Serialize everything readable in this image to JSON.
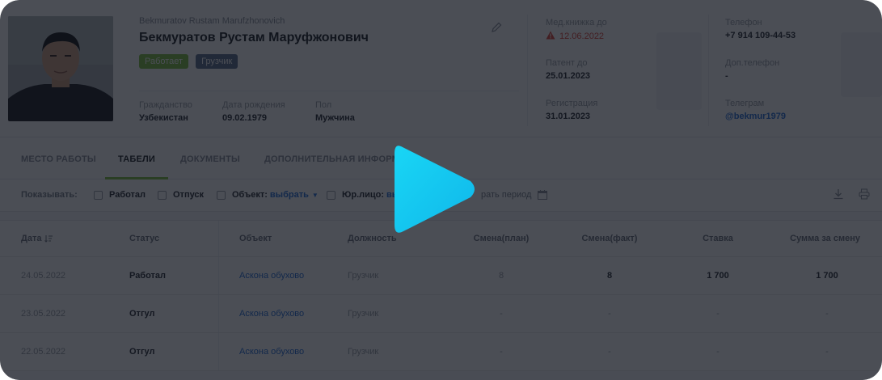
{
  "profile": {
    "latin_name": "Bekmuratov Rustam Marufzhonovich",
    "full_name": "Бекмуратов Рустам Маруфжонович",
    "badges": {
      "status": "Работает",
      "role": "Грузчик"
    },
    "citizenship": {
      "label": "Гражданство",
      "value": "Узбекистан"
    },
    "birth_date": {
      "label": "Дата рождения",
      "value": "09.02.1979"
    },
    "gender": {
      "label": "Пол",
      "value": "Мужчина"
    },
    "patent": {
      "label": "Мед.книжка до",
      "value": "12.06.2022"
    },
    "patent_from": {
      "label": "Патент до",
      "value": "25.01.2023"
    },
    "registration": {
      "label": "Регистрация",
      "value": "31.01.2023"
    },
    "phone": {
      "label": "Телефон",
      "value": "+7 914 109-44-53"
    },
    "extra_phone": {
      "label": "Доп.телефон",
      "value": "-"
    },
    "telegram": {
      "label": "Телеграм",
      "value": "@bekmur1979"
    }
  },
  "tabs": [
    {
      "label": "МЕСТО РАБОТЫ"
    },
    {
      "label": "ТАБЕЛИ"
    },
    {
      "label": "ДОКУМЕНТЫ"
    },
    {
      "label": "ДОПОЛНИТЕЛЬНАЯ ИНФОРМ"
    }
  ],
  "filters": {
    "show_label": "Показывать:",
    "worked": "Работал",
    "vacation": "Отпуск",
    "object_label": "Объект:",
    "object_value": "выбрать",
    "legal_label": "Юр.лицо:",
    "legal_value": "вы",
    "period": "рать период"
  },
  "table": {
    "headers": {
      "date": "Дата",
      "status": "Статус",
      "object": "Объект",
      "position": "Должность",
      "plan": "Смена(план)",
      "fact": "Смена(факт)",
      "rate": "Ставка",
      "sum": "Сумма за смену"
    },
    "rows": [
      {
        "date": "24.05.2022",
        "status": "Работал",
        "object": "Аскона обухово",
        "position": "Грузчик",
        "plan": "8",
        "fact": "8",
        "rate": "1 700",
        "sum": "1 700"
      },
      {
        "date": "23.05.2022",
        "status": "Отгул",
        "object": "Аскона обухово",
        "position": "Грузчик",
        "plan": "-",
        "fact": "-",
        "rate": "-",
        "sum": "-"
      },
      {
        "date": "22.05.2022",
        "status": "Отгул",
        "object": "Аскона обухово",
        "position": "Грузчик",
        "plan": "-",
        "fact": "-",
        "rate": "-",
        "sum": "-"
      }
    ]
  },
  "colors": {
    "accent_green": "#7fc241",
    "link_blue": "#2a6fd6",
    "warning_red": "#e0483d",
    "play_cyan": "#14c8f0"
  },
  "icons": [
    "edit-icon",
    "warning-icon",
    "sort-icon",
    "calendar-icon",
    "download-icon",
    "print-icon",
    "play-icon"
  ]
}
